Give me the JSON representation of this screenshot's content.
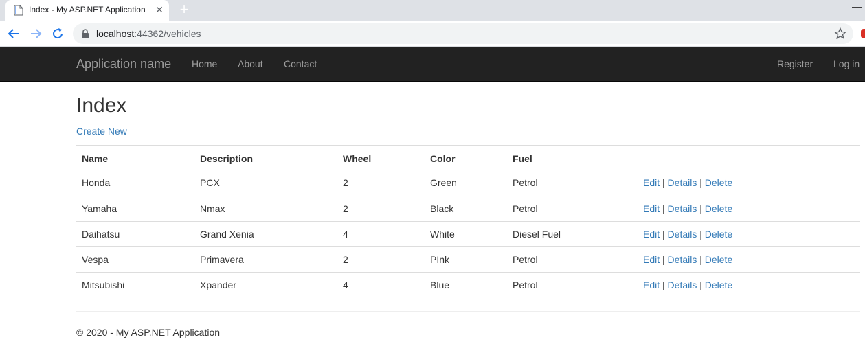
{
  "browser": {
    "tab_title": "Index - My ASP.NET Application",
    "url_host": "localhost",
    "url_port_path": ":44362/vehicles"
  },
  "navbar": {
    "brand": "Application name",
    "links": [
      "Home",
      "About",
      "Contact"
    ],
    "register": "Register",
    "login": "Log in"
  },
  "page": {
    "title": "Index",
    "create_new": "Create New"
  },
  "table": {
    "headers": {
      "name": "Name",
      "description": "Description",
      "wheel": "Wheel",
      "color": "Color",
      "fuel": "Fuel"
    },
    "rows": [
      {
        "name": "Honda",
        "description": "PCX",
        "wheel": "2",
        "color": "Green",
        "fuel": "Petrol"
      },
      {
        "name": "Yamaha",
        "description": "Nmax",
        "wheel": "2",
        "color": "Black",
        "fuel": "Petrol"
      },
      {
        "name": "Daihatsu",
        "description": "Grand Xenia",
        "wheel": "4",
        "color": "White",
        "fuel": "Diesel Fuel"
      },
      {
        "name": "Vespa",
        "description": "Primavera",
        "wheel": "2",
        "color": "PInk",
        "fuel": "Petrol"
      },
      {
        "name": "Mitsubishi",
        "description": "Xpander",
        "wheel": "4",
        "color": "Blue",
        "fuel": "Petrol"
      }
    ],
    "actions": {
      "edit": "Edit",
      "details": "Details",
      "delete": "Delete",
      "separator": "|"
    }
  },
  "footer": {
    "text": "© 2020 - My ASP.NET Application"
  },
  "colors": {
    "navbar_bg": "#222222",
    "link": "#337ab7",
    "nav_text": "#9d9d9d"
  },
  "icons": [
    "page-favicon-icon",
    "close-icon",
    "plus-icon",
    "back-arrow-icon",
    "forward-arrow-icon",
    "reload-icon",
    "lock-icon",
    "star-icon"
  ]
}
